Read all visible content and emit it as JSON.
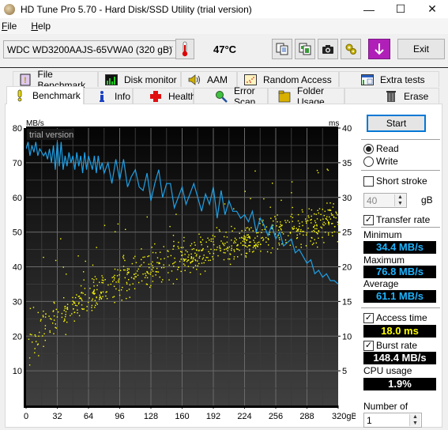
{
  "window": {
    "title": "HD Tune Pro 5.70 - Hard Disk/SSD Utility (trial version)",
    "controls": {
      "minimize": "—",
      "maximize": "☐",
      "close": "✕"
    }
  },
  "menu": [
    {
      "label": "File",
      "accel": "F",
      "rest": "ile"
    },
    {
      "label": "Help",
      "accel": "H",
      "rest": "elp"
    }
  ],
  "toolbar": {
    "drive": "WDC WD3200AAJS-65VWA0 (320 gB)",
    "temperature": "47°C",
    "buttons": [
      "copy-text-icon",
      "copy-image-icon",
      "screenshot-icon",
      "options-icon",
      "save-icon"
    ],
    "exit_label": "Exit"
  },
  "tabs": {
    "row1": [
      {
        "label": "File Benchmark",
        "icon": "file-benchmark-icon"
      },
      {
        "label": "Disk monitor",
        "icon": "disk-monitor-icon"
      },
      {
        "label": "AAM",
        "icon": "speaker-icon"
      },
      {
        "label": "Random Access",
        "icon": "random-access-icon"
      },
      {
        "label": "Extra tests",
        "icon": "extra-tests-icon"
      }
    ],
    "row2": [
      {
        "label": "Benchmark",
        "icon": "benchmark-icon",
        "active": true
      },
      {
        "label": "Info",
        "icon": "info-icon"
      },
      {
        "label": "Health",
        "icon": "health-cross-icon"
      },
      {
        "label": "Error Scan",
        "icon": "magnifier-icon"
      },
      {
        "label": "Folder Usage",
        "icon": "folder-icon"
      },
      {
        "label": "Erase",
        "icon": "trash-icon"
      }
    ]
  },
  "controls": {
    "start_label": "Start",
    "read_label": "Read",
    "write_label": "Write",
    "mode": "Read",
    "short_stroke_label": "Short stroke",
    "short_stroke_checked": false,
    "short_stroke_value": "40",
    "short_stroke_unit": "gB",
    "transfer_rate_label": "Transfer rate",
    "transfer_rate_checked": true,
    "minimum_label": "Minimum",
    "minimum_value": "34.4 MB/s",
    "maximum_label": "Maximum",
    "maximum_value": "76.8 MB/s",
    "average_label": "Average",
    "average_value": "61.1 MB/s",
    "access_time_label": "Access time",
    "access_time_checked": true,
    "access_time_value": "18.0 ms",
    "burst_rate_label": "Burst rate",
    "burst_rate_checked": true,
    "burst_rate_value": "148.4 MB/s",
    "cpu_label": "CPU usage",
    "cpu_value": "1.9%",
    "passes_label": "Number of passes",
    "passes_value": "1",
    "colors": {
      "transfer": "#1ea0e6",
      "access": "#ffff00",
      "cpu": "#ffffff"
    }
  },
  "chart_data": {
    "type": "line",
    "watermark": "trial version",
    "xlabel": "gB",
    "ylabel_left": "MB/s",
    "ylabel_right": "ms",
    "xlim": [
      0,
      320
    ],
    "ylim_left": [
      0,
      80
    ],
    "ylim_right": [
      0,
      40
    ],
    "x_ticks": [
      "0",
      "32",
      "64",
      "96",
      "128",
      "160",
      "192",
      "224",
      "256",
      "288",
      "320gB"
    ],
    "y_ticks_left": [
      "10",
      "20",
      "30",
      "40",
      "50",
      "60",
      "70",
      "80"
    ],
    "y_ticks_right": [
      "5",
      "10",
      "15",
      "20",
      "25",
      "30",
      "35",
      "40"
    ],
    "grid": true,
    "series": [
      {
        "name": "Transfer rate (MB/s)",
        "axis": "left",
        "color": "#1ea0e6",
        "x": [
          0,
          2,
          4,
          6,
          8,
          10,
          12,
          14,
          16,
          18,
          20,
          22,
          24,
          26,
          28,
          30,
          32,
          34,
          36,
          38,
          40,
          42,
          44,
          46,
          48,
          50,
          52,
          54,
          56,
          58,
          60,
          62,
          64,
          66,
          68,
          70,
          72,
          74,
          76,
          78,
          80,
          84,
          88,
          92,
          96,
          100,
          104,
          108,
          112,
          116,
          120,
          124,
          128,
          132,
          136,
          140,
          144,
          148,
          152,
          156,
          160,
          164,
          168,
          172,
          176,
          180,
          184,
          188,
          192,
          196,
          200,
          204,
          208,
          212,
          216,
          220,
          224,
          228,
          232,
          236,
          240,
          244,
          248,
          252,
          256,
          260,
          264,
          268,
          272,
          276,
          280,
          284,
          288,
          292,
          296,
          300,
          304,
          308,
          312,
          316,
          320
        ],
        "values": [
          74,
          76,
          72,
          75,
          73,
          76,
          72,
          74,
          73,
          72,
          73,
          71,
          74,
          70,
          75,
          68,
          76,
          69,
          76,
          68,
          72,
          69,
          73,
          70,
          72,
          68,
          73,
          69,
          72,
          67,
          73,
          68,
          72,
          70,
          68,
          72,
          67,
          72,
          68,
          70,
          67,
          70,
          64,
          71,
          65,
          71,
          63,
          66,
          68,
          63,
          62,
          67,
          59,
          64,
          68,
          60,
          64,
          64,
          57,
          60,
          63,
          58,
          61,
          64,
          60,
          56,
          61,
          58,
          63,
          54,
          62,
          55,
          59,
          56,
          56,
          54,
          55,
          53,
          56,
          50,
          54,
          52,
          49,
          52,
          48,
          50,
          46,
          47,
          48,
          44,
          45,
          43,
          41,
          42,
          38,
          39,
          37,
          38,
          36,
          36,
          35
        ]
      },
      {
        "name": "Access time (ms)",
        "axis": "right",
        "color": "#ffff00",
        "type": "scatter",
        "description": "≈800 random access points trending from ~4–14 ms near 0 gB to ~20–30 ms near 320 gB; average 18.0 ms",
        "trend": {
          "x": [
            0,
            32,
            64,
            96,
            128,
            160,
            192,
            224,
            256,
            288,
            320
          ],
          "low": [
            4,
            9,
            12,
            14,
            16,
            17,
            19,
            20,
            21,
            22,
            23
          ],
          "high": [
            13,
            17,
            20,
            22,
            24,
            25,
            26,
            27,
            29,
            30,
            31
          ]
        }
      }
    ]
  }
}
